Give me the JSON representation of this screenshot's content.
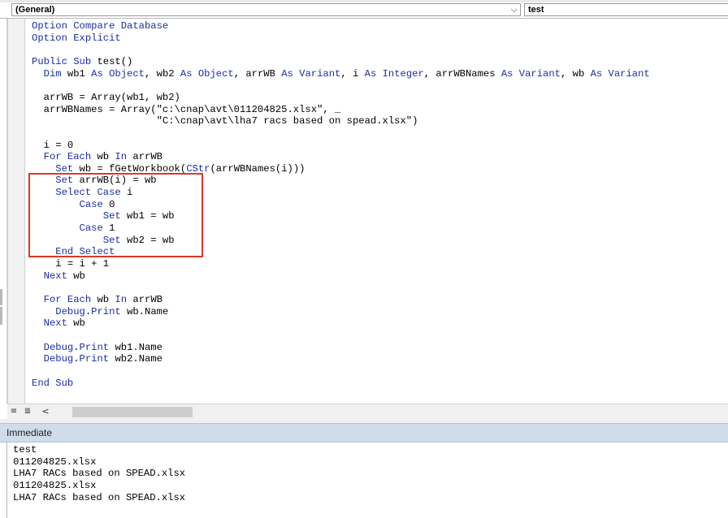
{
  "object_combo": {
    "value": "(General)",
    "arrow": "⌵"
  },
  "procedure_combo": {
    "value": "test"
  },
  "code_lines": [
    [
      {
        "t": "Option Compare Database",
        "k": 1
      }
    ],
    [
      {
        "t": "Option Explicit",
        "k": 1
      }
    ],
    [],
    [
      {
        "t": "Public Sub",
        "k": 1
      },
      {
        "t": " test()"
      }
    ],
    [
      {
        "t": "  "
      },
      {
        "t": "Dim",
        "k": 1
      },
      {
        "t": " wb1 "
      },
      {
        "t": "As Object",
        "k": 1
      },
      {
        "t": ", wb2 "
      },
      {
        "t": "As Object",
        "k": 1
      },
      {
        "t": ", arrWB "
      },
      {
        "t": "As Variant",
        "k": 1
      },
      {
        "t": ", i "
      },
      {
        "t": "As Integer",
        "k": 1
      },
      {
        "t": ", arrWBNames "
      },
      {
        "t": "As Variant",
        "k": 1
      },
      {
        "t": ", wb "
      },
      {
        "t": "As Variant",
        "k": 1
      }
    ],
    [],
    [
      {
        "t": "  arrWB = Array(wb1, wb2)"
      }
    ],
    [
      {
        "t": "  arrWBNames = Array(\"c:\\cnap\\avt\\011204825.xlsx\", _"
      }
    ],
    [
      {
        "t": "                     \"C:\\cnap\\avt\\lha7 racs based on spead.xlsx\")"
      }
    ],
    [],
    [
      {
        "t": "  i = 0"
      }
    ],
    [
      {
        "t": "  "
      },
      {
        "t": "For Each",
        "k": 1
      },
      {
        "t": " wb "
      },
      {
        "t": "In",
        "k": 1
      },
      {
        "t": " arrWB"
      }
    ],
    [
      {
        "t": "    "
      },
      {
        "t": "Set",
        "k": 1
      },
      {
        "t": " wb = fGetWorkbook("
      },
      {
        "t": "CStr",
        "k": 1
      },
      {
        "t": "(arrWBNames(i)))"
      }
    ],
    [
      {
        "t": "    "
      },
      {
        "t": "Set",
        "k": 1
      },
      {
        "t": " arrWB(i) = wb"
      }
    ],
    [
      {
        "t": "    "
      },
      {
        "t": "Select Case",
        "k": 1
      },
      {
        "t": " i"
      }
    ],
    [
      {
        "t": "        "
      },
      {
        "t": "Case",
        "k": 1
      },
      {
        "t": " 0"
      }
    ],
    [
      {
        "t": "            "
      },
      {
        "t": "Set",
        "k": 1
      },
      {
        "t": " wb1 = wb"
      }
    ],
    [
      {
        "t": "        "
      },
      {
        "t": "Case",
        "k": 1
      },
      {
        "t": " 1"
      }
    ],
    [
      {
        "t": "            "
      },
      {
        "t": "Set",
        "k": 1
      },
      {
        "t": " wb2 = wb"
      }
    ],
    [
      {
        "t": "    "
      },
      {
        "t": "End Select",
        "k": 1
      }
    ],
    [
      {
        "t": "    i = i + 1"
      }
    ],
    [
      {
        "t": "  "
      },
      {
        "t": "Next",
        "k": 1
      },
      {
        "t": " wb"
      }
    ],
    [],
    [
      {
        "t": "  "
      },
      {
        "t": "For Each",
        "k": 1
      },
      {
        "t": " wb "
      },
      {
        "t": "In",
        "k": 1
      },
      {
        "t": " arrWB"
      }
    ],
    [
      {
        "t": "    "
      },
      {
        "t": "Debug",
        "k": 1
      },
      {
        "t": "."
      },
      {
        "t": "Print",
        "k": 1
      },
      {
        "t": " wb.Name"
      }
    ],
    [
      {
        "t": "  "
      },
      {
        "t": "Next",
        "k": 1
      },
      {
        "t": " wb"
      }
    ],
    [],
    [
      {
        "t": "  "
      },
      {
        "t": "Debug",
        "k": 1
      },
      {
        "t": "."
      },
      {
        "t": "Print",
        "k": 1
      },
      {
        "t": " wb1.Name"
      }
    ],
    [
      {
        "t": "  "
      },
      {
        "t": "Debug",
        "k": 1
      },
      {
        "t": "."
      },
      {
        "t": "Print",
        "k": 1
      },
      {
        "t": " wb2.Name"
      }
    ],
    [],
    [
      {
        "t": "End Sub",
        "k": 1
      }
    ]
  ],
  "colors": {
    "keyword": "#1c2ea3",
    "highlight_box": "#d9382c",
    "immediate_header": "#cfdcea"
  },
  "view_buttons": {
    "procedure_view": "≡",
    "full_module_view": "≣"
  },
  "scroll": {
    "left_arrow": "<"
  },
  "immediate": {
    "title": "Immediate",
    "lines": [
      "test",
      "011204825.xlsx",
      "LHA7 RACs based on SPEAD.xlsx",
      "011204825.xlsx",
      "LHA7 RACs based on SPEAD.xlsx"
    ]
  }
}
